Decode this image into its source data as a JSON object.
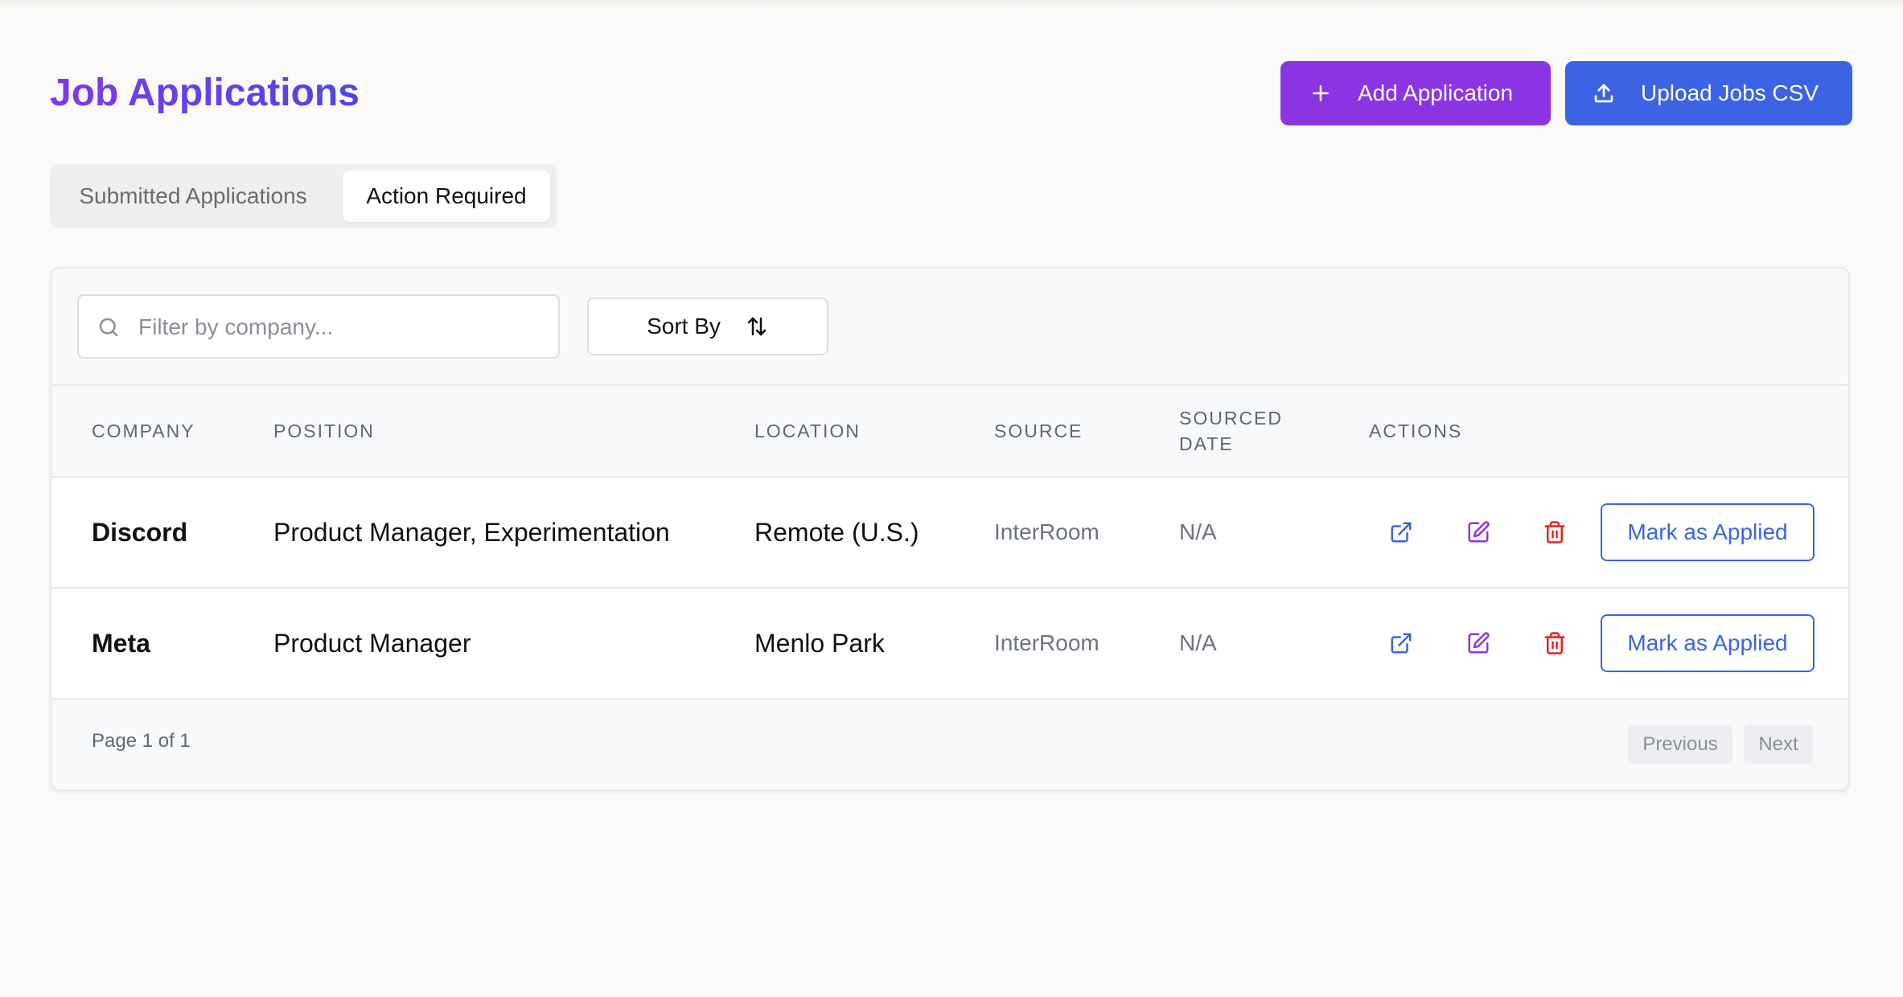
{
  "header": {
    "title": "Job Applications",
    "add_label": "Add Application",
    "upload_label": "Upload Jobs CSV"
  },
  "tabs": [
    {
      "label": "Submitted Applications",
      "active": false
    },
    {
      "label": "Action Required",
      "active": true
    }
  ],
  "toolbar": {
    "search_placeholder": "Filter by company...",
    "search_value": "",
    "sort_label": "Sort By"
  },
  "table": {
    "columns": [
      "COMPANY",
      "POSITION",
      "LOCATION",
      "SOURCE",
      "SOURCED DATE",
      "ACTIONS"
    ],
    "rows": [
      {
        "company": "Discord",
        "position": "Product Manager, Experimentation",
        "location": "Remote (U.S.)",
        "source": "InterRoom",
        "sourced_date": "N/A",
        "action_label": "Mark as Applied"
      },
      {
        "company": "Meta",
        "position": "Product Manager",
        "location": "Menlo Park",
        "source": "InterRoom",
        "sourced_date": "N/A",
        "action_label": "Mark as Applied"
      }
    ]
  },
  "pagination": {
    "info": "Page 1 of 1",
    "previous_label": "Previous",
    "next_label": "Next"
  },
  "icons": {
    "add": "plus-icon",
    "upload": "upload-icon",
    "search": "search-icon",
    "sort": "sort-arrows-icon",
    "open": "external-link-icon",
    "edit": "edit-icon",
    "delete": "trash-icon"
  },
  "colors": {
    "title_gradient_start": "#7c3aed",
    "title_gradient_end": "#4f46e5",
    "add_button": "#8b34e4",
    "upload_button": "#3b63e3",
    "open_icon": "#3b63e3",
    "edit_icon": "#9333ea",
    "delete_icon": "#dc2626"
  }
}
